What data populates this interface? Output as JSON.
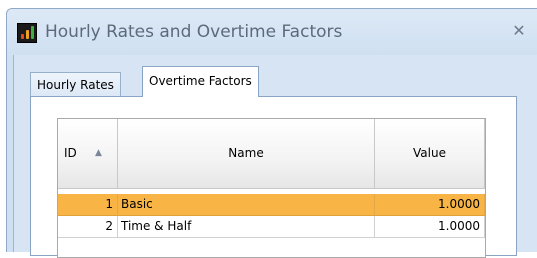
{
  "window": {
    "title": "Hourly Rates and Overtime Factors",
    "close_glyph": "✕",
    "icon": "chart-app-icon"
  },
  "tabs": [
    {
      "label": "Hourly Rates",
      "active": false
    },
    {
      "label": "Overtime Factors",
      "active": true
    }
  ],
  "grid": {
    "columns": [
      {
        "label": "ID",
        "sort": "ascending"
      },
      {
        "label": "Name"
      },
      {
        "label": "Value"
      }
    ],
    "sort_glyph": "▲",
    "rows": [
      {
        "id": "1",
        "name": "Basic",
        "value": "1.0000",
        "selected": true
      },
      {
        "id": "2",
        "name": "Time & Half",
        "value": "1.0000",
        "selected": false
      }
    ]
  },
  "colors": {
    "selection": "#f8b545",
    "title_text": "#5c6a7c",
    "frame": "#cfe0f3"
  }
}
